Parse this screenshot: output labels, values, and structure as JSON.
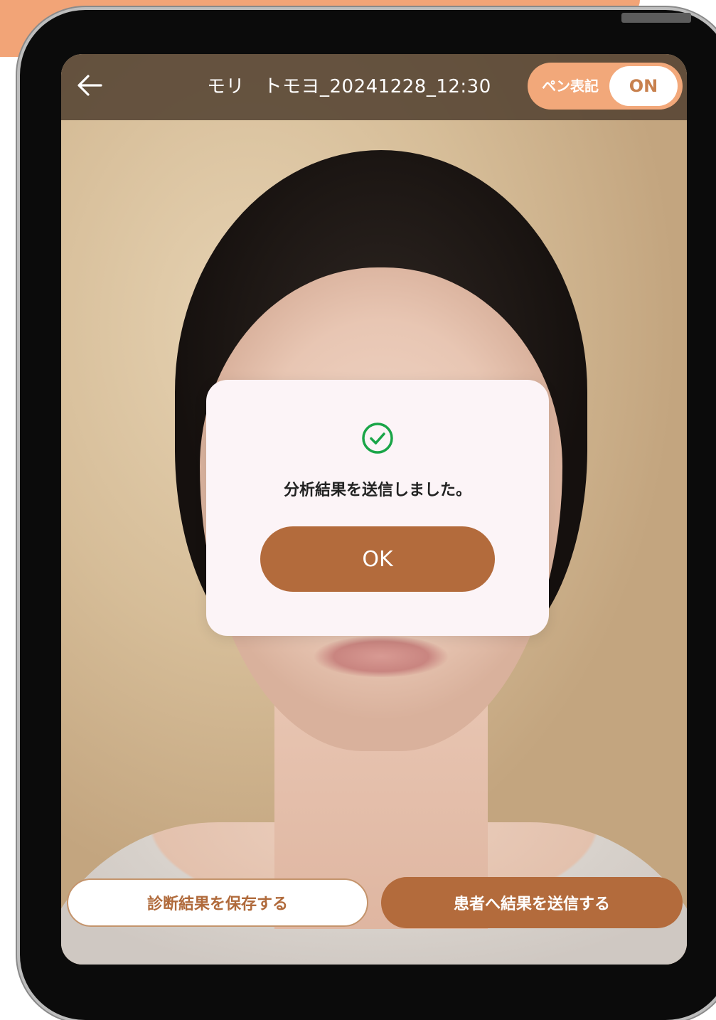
{
  "header": {
    "title": "モリ　トモヨ_20241228_12:30",
    "pen_toggle": {
      "label": "ペン表記",
      "state": "ON"
    }
  },
  "dialog": {
    "message": "分析結果を送信しました。",
    "ok_label": "OK",
    "icon": "check-circle-icon"
  },
  "actions": {
    "save_label": "診断結果を保存する",
    "send_label": "患者へ結果を送信する"
  },
  "colors": {
    "accent": "#f2a87a",
    "primary_button": "#b36b3c",
    "success": "#1aa548",
    "header_bg": "#524030"
  }
}
